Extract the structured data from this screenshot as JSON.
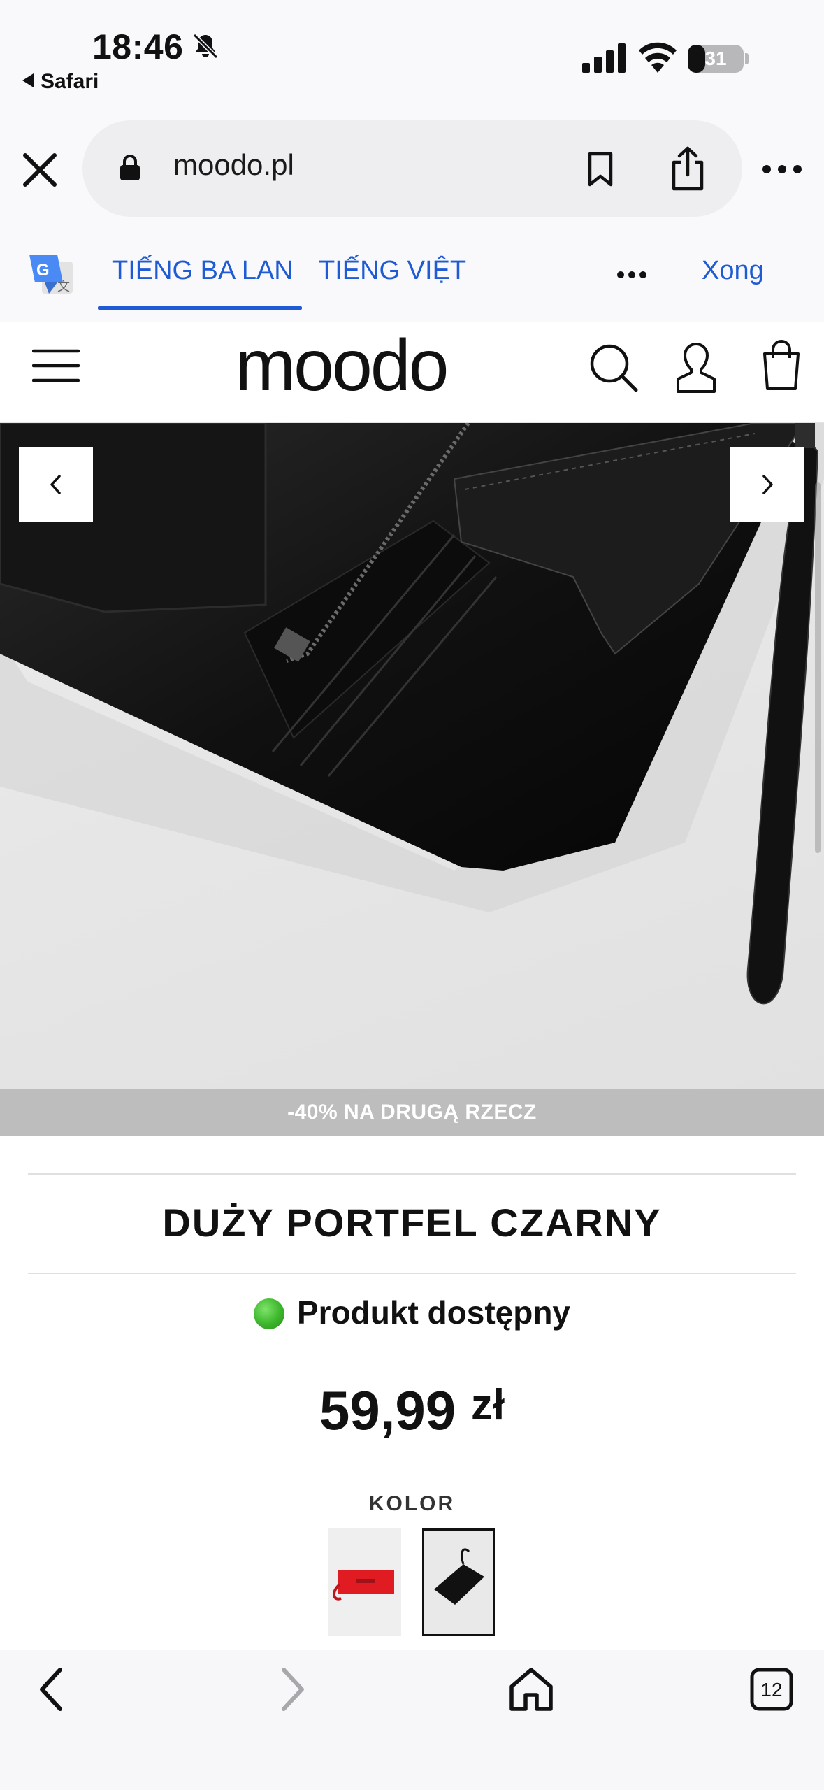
{
  "status_bar": {
    "time": "18:46",
    "back_app": "Safari",
    "battery_level": "31",
    "battery_fraction": 0.31
  },
  "url_bar": {
    "url": "moodo.pl"
  },
  "translate_bar": {
    "source_language": "TIẾNG BA LAN",
    "target_language": "TIẾNG VIỆT",
    "done_label": "Xong"
  },
  "site": {
    "logo_text": "moodo"
  },
  "gallery": {
    "promo_text": "-40% NA DRUGĄ RZECZ"
  },
  "product": {
    "title": "DUŻY PORTFEL CZARNY",
    "availability": "Produkt dostępny",
    "price": "59,99",
    "currency": "zł",
    "color_label": "KOLOR"
  },
  "toolbar": {
    "tabs_count": "12"
  },
  "colors": {
    "accent_blue": "#1f5bd4",
    "promo_bar": "#bdbdbd",
    "available_green": "#3bb52a"
  }
}
